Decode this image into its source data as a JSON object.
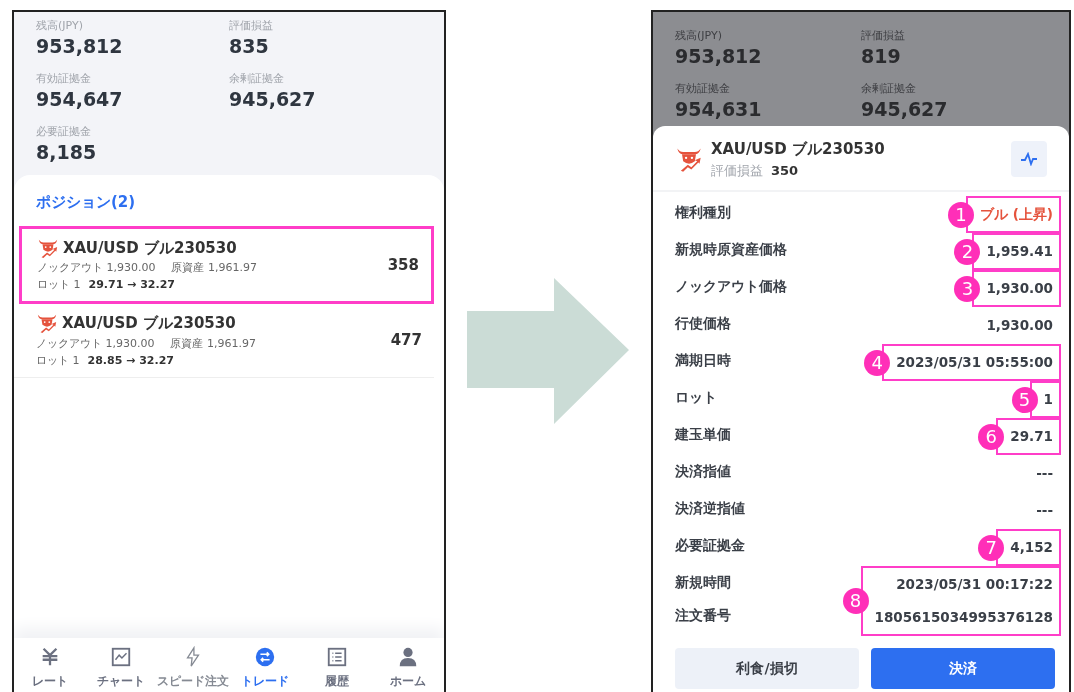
{
  "left_screen": {
    "summary": [
      {
        "label": "残高(JPY)",
        "value": "953,812"
      },
      {
        "label": "評価損益",
        "value": "835"
      },
      {
        "label": "有効証拠金",
        "value": "954,647"
      },
      {
        "label": "余剰証拠金",
        "value": "945,627"
      },
      {
        "label": "必要証拠金",
        "value": "8,185"
      }
    ],
    "positions_title": "ポジション(2)",
    "positions": [
      {
        "name": "XAU/USD ブル230530",
        "knockout": "ノックアウト 1,930.00",
        "underlying": "原資産 1,961.97",
        "lot": "ロット 1",
        "prices": "29.71 → 32.27",
        "pnl": "358",
        "highlighted": true
      },
      {
        "name": "XAU/USD ブル230530",
        "knockout": "ノックアウト 1,930.00",
        "underlying": "原資産 1,961.97",
        "lot": "ロット 1",
        "prices": "28.85 → 32.27",
        "pnl": "477",
        "highlighted": false
      }
    ],
    "nav": [
      {
        "kind": "yen",
        "label": "レート",
        "selected": false,
        "disabled": false
      },
      {
        "kind": "chart",
        "label": "チャート",
        "selected": false,
        "disabled": false
      },
      {
        "kind": "bolt",
        "label": "スピード注文",
        "selected": false,
        "disabled": true
      },
      {
        "kind": "swap",
        "label": "トレード",
        "selected": true,
        "disabled": false
      },
      {
        "kind": "list",
        "label": "履歴",
        "selected": false,
        "disabled": false
      },
      {
        "kind": "person",
        "label": "ホーム",
        "selected": false,
        "disabled": false
      }
    ]
  },
  "right_screen": {
    "summary": [
      {
        "label": "残高(JPY)",
        "value": "953,812"
      },
      {
        "label": "評価損益",
        "value": "819"
      },
      {
        "label": "有効証拠金",
        "value": "954,631"
      },
      {
        "label": "余剰証拠金",
        "value": "945,627"
      }
    ],
    "sheet": {
      "title": "XAU/USD ブル230530",
      "pnl_label": "評価損益",
      "pnl": "350",
      "groups": [
        {
          "annotation": "1",
          "rows": [
            {
              "label": "権利種別",
              "value": "ブル (上昇)",
              "color": "#e5533d"
            }
          ]
        },
        {
          "annotation": "2",
          "rows": [
            {
              "label": "新規時原資産価格",
              "value": "1,959.41"
            }
          ]
        },
        {
          "annotation": "3",
          "rows": [
            {
              "label": "ノックアウト価格",
              "value": "1,930.00"
            }
          ]
        },
        {
          "rows": [
            {
              "label": "行使価格",
              "value": "1,930.00"
            }
          ]
        },
        {
          "annotation": "4",
          "rows": [
            {
              "label": "満期日時",
              "value": "2023/05/31  05:55:00"
            }
          ]
        },
        {
          "annotation": "5",
          "rows": [
            {
              "label": "ロット",
              "value": "1"
            }
          ]
        },
        {
          "annotation": "6",
          "rows": [
            {
              "label": "建玉単価",
              "value": "29.71"
            }
          ]
        },
        {
          "rows": [
            {
              "label": "決済指値",
              "value": "---"
            }
          ]
        },
        {
          "rows": [
            {
              "label": "決済逆指値",
              "value": "---"
            }
          ]
        },
        {
          "annotation": "7",
          "rows": [
            {
              "label": "必要証拠金",
              "value": "4,152"
            }
          ]
        },
        {
          "annotation": "8",
          "rows": [
            {
              "label": "新規時間",
              "value": "2023/05/31 00:17:22"
            },
            {
              "label": "注文番号",
              "value": "1805615034995376128"
            }
          ]
        }
      ],
      "buttons": [
        {
          "label": "利食/損切",
          "kind": "secondary"
        },
        {
          "label": "決済",
          "kind": "primary"
        }
      ]
    }
  }
}
